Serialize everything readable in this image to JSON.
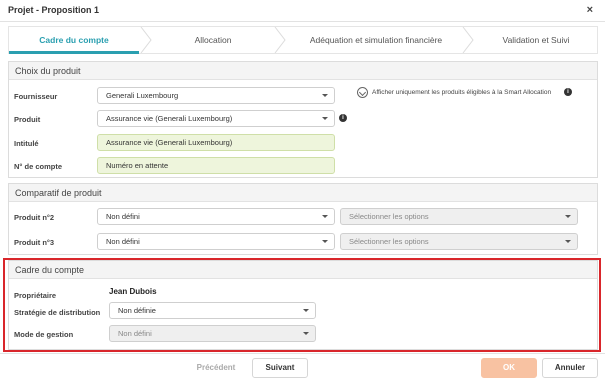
{
  "dialog": {
    "title": "Projet - Proposition 1",
    "close_glyph": "×"
  },
  "steps": [
    {
      "label": "Cadre du compte",
      "active": true
    },
    {
      "label": "Allocation",
      "active": false
    },
    {
      "label": "Adéquation et simulation financière",
      "active": false
    },
    {
      "label": "Validation et Suivi",
      "active": false
    }
  ],
  "produit": {
    "header": "Choix du produit",
    "fournisseur_label": "Fournisseur",
    "fournisseur_value": "Generali Luxembourg",
    "produit_label": "Produit",
    "produit_value": "Assurance vie (Generali Luxembourg)",
    "intitule_label": "Intitulé",
    "intitule_value": "Assurance vie (Generali Luxembourg)",
    "compte_label": "N° de compte",
    "compte_value": "Numéro en attente",
    "smart_text": "Afficher uniquement les produits éligibles à la Smart Allocation",
    "info_glyph": "i"
  },
  "comparatif": {
    "header": "Comparatif de produit",
    "p2_label": "Produit n°2",
    "p2_value": "Non défini",
    "p2_options": "Sélectionner les options",
    "p3_label": "Produit n°3",
    "p3_value": "Non défini",
    "p3_options": "Sélectionner les options"
  },
  "cadre": {
    "header": "Cadre du compte",
    "proprietaire_label": "Propriétaire",
    "proprietaire_value": "Jean Dubois",
    "strategie_label": "Stratégie de distribution",
    "strategie_value": "Non définie",
    "gestion_label": "Mode de gestion",
    "gestion_value": "Non défini"
  },
  "footer": {
    "prev_label": "Précédent",
    "next_label": "Suivant",
    "ok_label": "OK",
    "cancel_label": "Annuler"
  },
  "colors": {
    "accent": "#2a9fb0",
    "highlight": "#d9262b",
    "ok_button": "#f8c2a2",
    "green_field": "#eef5dc"
  }
}
